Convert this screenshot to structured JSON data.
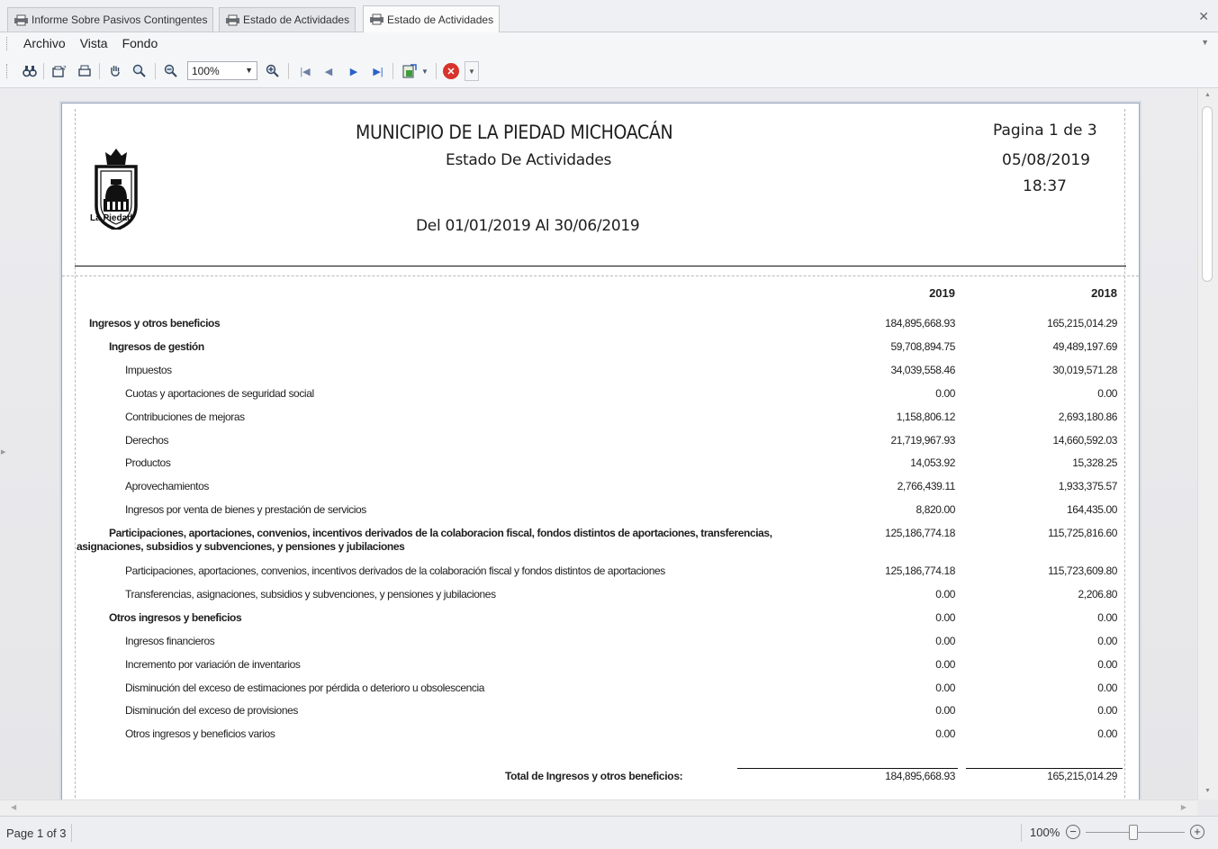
{
  "tabs": [
    {
      "label": "Informe Sobre Pasivos Contingentes"
    },
    {
      "label": "Estado de Actividades"
    },
    {
      "label": "Estado de Actividades"
    }
  ],
  "menu": {
    "items": [
      "Archivo",
      "Vista",
      "Fondo"
    ]
  },
  "toolbar": {
    "zoom_value": "100%",
    "icons": [
      "find-icon",
      "parameters-icon",
      "print-icon",
      "hand-tool-icon",
      "magnifier-icon",
      "zoom-out-icon",
      "zoom-in-icon",
      "first-page-icon",
      "previous-page-icon",
      "next-page-icon",
      "last-page-icon",
      "export-icon",
      "close-preview-icon"
    ]
  },
  "report": {
    "title": "MUNICIPIO DE LA PIEDAD MICHOACÁN",
    "subtitle": "Estado De Actividades",
    "period": "Del 01/01/2019 Al 30/06/2019",
    "page_info": "Pagina 1 de 3",
    "date": "05/08/2019",
    "time": "18:37",
    "logo_text": "La Piedad",
    "col_2019": "2019",
    "col_2018": "2018",
    "rows": [
      {
        "label": "Ingresos y otros beneficios",
        "v2019": "184,895,668.93",
        "v2018": "165,215,014.29"
      },
      {
        "label": "Ingresos de gestión",
        "v2019": "59,708,894.75",
        "v2018": "49,489,197.69"
      },
      {
        "label": "Impuestos",
        "v2019": "34,039,558.46",
        "v2018": "30,019,571.28"
      },
      {
        "label": "Cuotas y aportaciones de seguridad social",
        "v2019": "0.00",
        "v2018": "0.00"
      },
      {
        "label": "Contribuciones de mejoras",
        "v2019": "1,158,806.12",
        "v2018": "2,693,180.86"
      },
      {
        "label": "Derechos",
        "v2019": "21,719,967.93",
        "v2018": "14,660,592.03"
      },
      {
        "label": "Productos",
        "v2019": "14,053.92",
        "v2018": "15,328.25"
      },
      {
        "label": "Aprovechamientos",
        "v2019": "2,766,439.11",
        "v2018": "1,933,375.57"
      },
      {
        "label": "Ingresos por venta de bienes y prestación de servicios",
        "v2019": "8,820.00",
        "v2018": "164,435.00"
      },
      {
        "label": "Participaciones, aportaciones, convenios, incentivos derivados de la colaboracion fiscal, fondos distintos de aportaciones, transferencias, asignaciones, subsidios y subvenciones, y pensiones y jubilaciones",
        "v2019": "125,186,774.18",
        "v2018": "115,725,816.60"
      },
      {
        "label": "Participaciones, aportaciones, convenios, incentivos derivados de la colaboración fiscal y fondos distintos de aportaciones",
        "v2019": "125,186,774.18",
        "v2018": "115,723,609.80"
      },
      {
        "label": "Transferencias, asignaciones, subsidios y subvenciones, y pensiones y jubilaciones",
        "v2019": "0.00",
        "v2018": "2,206.80"
      },
      {
        "label": "Otros ingresos y beneficios",
        "v2019": "0.00",
        "v2018": "0.00"
      },
      {
        "label": "Ingresos financieros",
        "v2019": "0.00",
        "v2018": "0.00"
      },
      {
        "label": "Incremento por variación de inventarios",
        "v2019": "0.00",
        "v2018": "0.00"
      },
      {
        "label": "Disminución del exceso de estimaciones por pérdida o deterioro u obsolescencia",
        "v2019": "0.00",
        "v2018": "0.00"
      },
      {
        "label": "Disminución del exceso de provisiones",
        "v2019": "0.00",
        "v2018": "0.00"
      },
      {
        "label": "Otros ingresos y beneficios varios",
        "v2019": "0.00",
        "v2018": "0.00"
      }
    ],
    "total_label": "Total de Ingresos y otros beneficios:",
    "total_2019": "184,895,668.93",
    "total_2018": "165,215,014.29"
  },
  "status": {
    "page": "Page 1 of 3",
    "zoom": "100%"
  }
}
